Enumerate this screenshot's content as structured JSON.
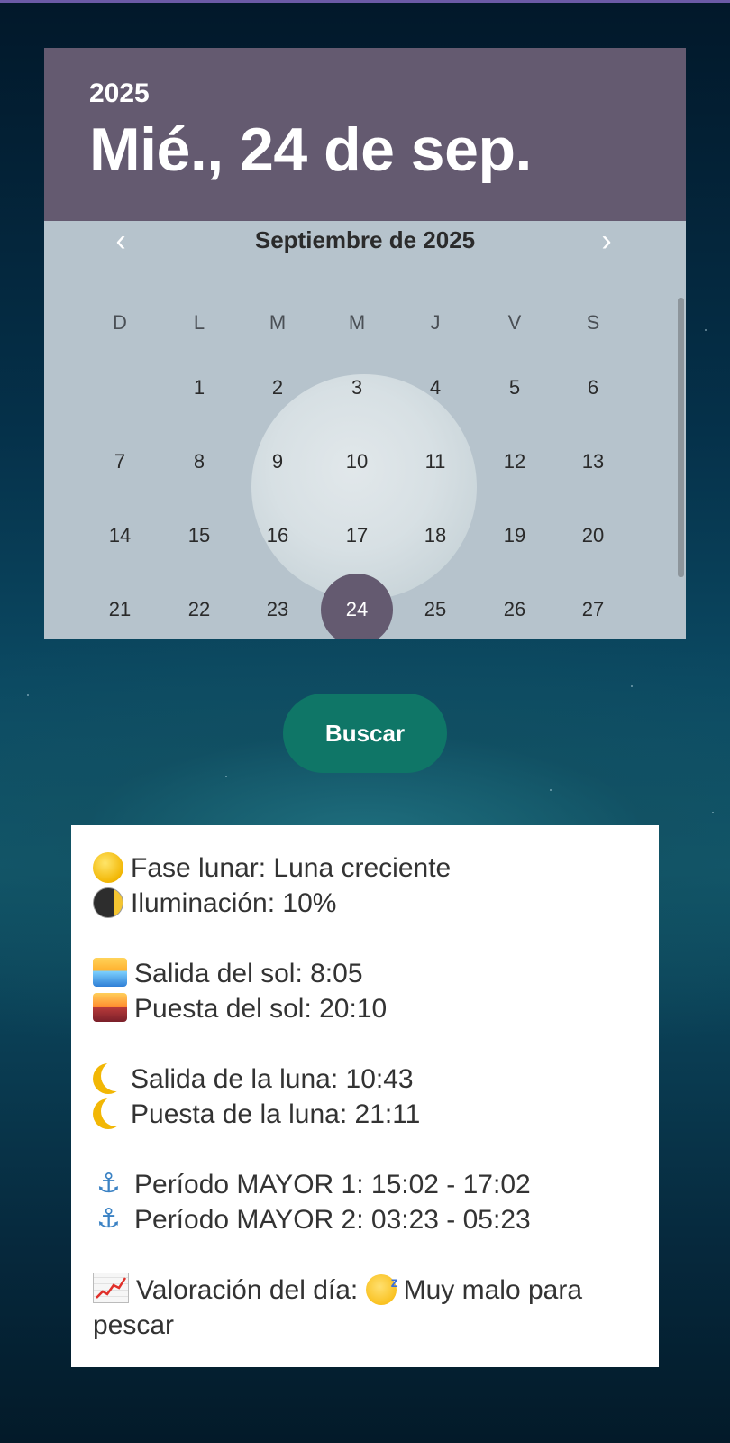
{
  "calendar": {
    "year": "2025",
    "selected_date": "Mié., 24 de sep.",
    "month_title": "Septiembre de 2025",
    "prev_icon": "chevron-left-icon",
    "next_icon": "chevron-right-icon",
    "weekdays": [
      "D",
      "L",
      "M",
      "M",
      "J",
      "V",
      "S"
    ],
    "weeks": [
      [
        "",
        "1",
        "2",
        "3",
        "4",
        "5",
        "6"
      ],
      [
        "7",
        "8",
        "9",
        "10",
        "11",
        "12",
        "13"
      ],
      [
        "14",
        "15",
        "16",
        "17",
        "18",
        "19",
        "20"
      ],
      [
        "21",
        "22",
        "23",
        "24",
        "25",
        "26",
        "27"
      ]
    ],
    "selected_day": "24",
    "header_color": "#645a70"
  },
  "search_button": {
    "label": "Buscar",
    "color": "#0f7667"
  },
  "info": {
    "moon_phase": "Fase lunar: Luna creciente",
    "illumination": "Iluminación: 10%",
    "sunrise": "Salida del sol: 8:05",
    "sunset": "Puesta del sol: 20:10",
    "moonrise": "Salida de la luna: 10:43",
    "moonset": "Puesta de la luna: 21:11",
    "major_period_1": "Período MAYOR 1: 15:02 - 17:02",
    "major_period_2": "Período MAYOR 2: 03:23 - 05:23",
    "rating_prefix": "Valoración del día:",
    "rating_value": "Muy malo para",
    "rating_value_cont": "pescar"
  }
}
